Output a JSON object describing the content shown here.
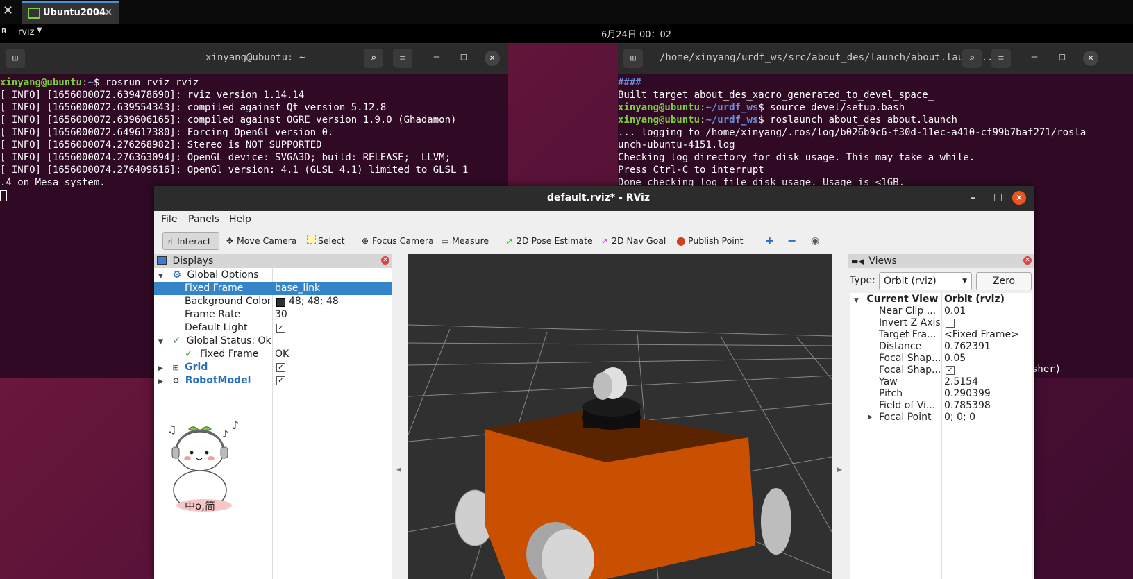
{
  "host": {
    "tab_label": "Ubuntu2004",
    "close_glyph": "✕"
  },
  "topbar": {
    "app_name": "rviz",
    "clock": "6月24日 00：02"
  },
  "term_left": {
    "title": "xinyang@ubuntu: ~",
    "prompt_user": "xinyang@ubuntu",
    "prompt_path": "~",
    "command": "$ rosrun rviz rviz",
    "lines": [
      "[ INFO] [1656000072.639478690]: rviz version 1.14.14",
      "[ INFO] [1656000072.639554343]: compiled against Qt version 5.12.8",
      "[ INFO] [1656000072.639606165]: compiled against OGRE version 1.9.0 (Ghadamon)",
      "[ INFO] [1656000072.649617380]: Forcing OpenGl version 0.",
      "[ INFO] [1656000074.276268982]: Stereo is NOT SUPPORTED",
      "[ INFO] [1656000074.276363094]: OpenGL device: SVGA3D; build: RELEASE;  LLVM;",
      "[ INFO] [1656000074.276409616]: OpenGl version: 4.1 (GLSL 4.1) limited to GLSL 1",
      ".4 on Mesa system."
    ]
  },
  "term_right": {
    "title": "/home/xinyang/urdf_ws/src/about_des/launch/about.launch...",
    "line1": "####",
    "line2": "Built target about_des_xacro_generated_to_devel_space_",
    "prompt_user": "xinyang@ubuntu",
    "prompt_path": "~/urdf_ws",
    "cmd1": "$ source devel/setup.bash",
    "cmd2": "$ roslaunch about_des about.launch",
    "lines": [
      "... logging to /home/xinyang/.ros/log/b026b9c6-f30d-11ec-a410-cf99b7baf271/rosla",
      "unch-ubuntu-4151.log",
      "Checking log directory for disk usage. This may take a while.",
      "Press Ctrl-C to interrupt",
      "Done checking log file disk usage. Usage is <1GB."
    ],
    "tail": "sher)"
  },
  "rviz": {
    "title": "default.rviz* - RViz",
    "menu": [
      "File",
      "Panels",
      "Help"
    ],
    "tools": {
      "interact": "Interact",
      "move_camera": "Move Camera",
      "select": "Select",
      "focus_camera": "Focus Camera",
      "measure": "Measure",
      "pose_estimate": "2D Pose Estimate",
      "nav_goal": "2D Nav Goal",
      "publish_point": "Publish Point"
    },
    "displays": {
      "header": "Displays",
      "global_options": "Global Options",
      "fixed_frame_label": "Fixed Frame",
      "fixed_frame_value": "base_link",
      "bg_label": "Background Color",
      "bg_value": "48; 48; 48",
      "bg_swatch": "#303030",
      "rate_label": "Frame Rate",
      "rate_value": "30",
      "light_label": "Default Light",
      "status_label": "Global Status: Ok",
      "status_ff_label": "Fixed Frame",
      "status_ff_value": "OK",
      "grid": "Grid",
      "robot": "RobotModel"
    },
    "views": {
      "header": "Views",
      "type_label": "Type:",
      "type_value": "Orbit (rviz)",
      "zero": "Zero",
      "current_view": "Current View",
      "current_view_value": "Orbit (rviz)",
      "rows": [
        {
          "label": "Near Clip ...",
          "value": "0.01"
        },
        {
          "label": "Invert Z Axis",
          "value": ""
        },
        {
          "label": "Target Fra...",
          "value": "<Fixed Frame>"
        },
        {
          "label": "Distance",
          "value": "0.762391"
        },
        {
          "label": "Focal Shap...",
          "value": "0.05"
        },
        {
          "label": "Focal Shap...",
          "value": ""
        },
        {
          "label": "Yaw",
          "value": "2.5154"
        },
        {
          "label": "Pitch",
          "value": "0.290399"
        },
        {
          "label": "Field of Vi...",
          "value": "0.785398"
        },
        {
          "label": "Focal Point",
          "value": "0; 0; 0"
        }
      ]
    },
    "mascot_text": "中o,简"
  },
  "colors": {
    "robot_body": "#c85000",
    "robot_top": "#5a2400",
    "selection": "#3584c8",
    "terminal_bg": "#300a24"
  }
}
